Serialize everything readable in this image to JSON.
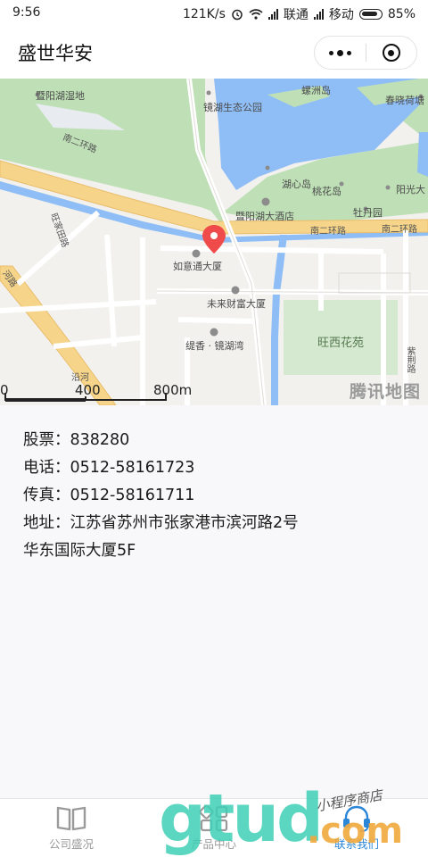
{
  "status_bar": {
    "time": "9:56",
    "net_speed": "121K/s",
    "carrier_1": "联通",
    "carrier_2": "移动",
    "battery": "85%"
  },
  "nav": {
    "title": "盛世华安"
  },
  "map": {
    "labels": {
      "wetland": "暨阳湖湿地",
      "luozhou": "螺洲岛",
      "chunxiao": "春晓荷塘",
      "eco_park": "镜湖生态公园",
      "huxin": "湖心岛",
      "taohua": "桃花岛",
      "yangguang": "阳光大",
      "hotel": "暨阳湖大酒店",
      "mudan": "牡丹园",
      "nan2_road_a": "南二环路",
      "nan2_road_b": "南二环路",
      "nan2_road_c": "南二环路",
      "wangjia": "旺家田路",
      "ruyitong": "如意通大厦",
      "weilai": "未来财富大厦",
      "wangxi": "旺西花苑",
      "tixiang": "缇香 · 镜湖湾",
      "zijing": "紫荆路",
      "yanhe": "沿河",
      "henshou": "河路"
    },
    "scale": {
      "zero": "0",
      "mid": "400",
      "end": "800m"
    },
    "brand": "腾讯地图",
    "colors": {
      "water": "#8fbdf5",
      "park": "#bfe0b6",
      "main_road": "#f6d58a",
      "marker": "#ef4b4b"
    }
  },
  "info": {
    "stock": "股票：838280",
    "phone": "电话：0512-58161723",
    "fax": "传真：0512-58161711",
    "address_line1": "地址：江苏省苏州市张家港市滨河路2号",
    "address_line2": "华东国际大厦5F"
  },
  "tabs": [
    {
      "label": "公司盛况",
      "icon": "book-icon"
    },
    {
      "label": "产品中心",
      "icon": "grid-icon"
    },
    {
      "label": "联系我们",
      "icon": "headset-icon"
    }
  ],
  "watermark": {
    "main": "gtud",
    "com": ".com",
    "script": "小程序商店"
  }
}
